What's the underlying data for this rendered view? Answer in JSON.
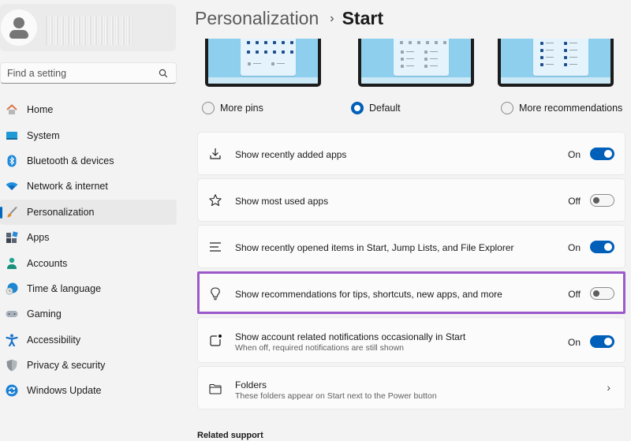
{
  "sidebar": {
    "search": {
      "placeholder": "Find a setting",
      "value": ""
    },
    "items": [
      {
        "label": "Home",
        "icon": "home-icon",
        "active": false
      },
      {
        "label": "System",
        "icon": "system-icon",
        "active": false
      },
      {
        "label": "Bluetooth & devices",
        "icon": "bluetooth-icon",
        "active": false
      },
      {
        "label": "Network & internet",
        "icon": "wifi-icon",
        "active": false
      },
      {
        "label": "Personalization",
        "icon": "brush-icon",
        "active": true
      },
      {
        "label": "Apps",
        "icon": "apps-icon",
        "active": false
      },
      {
        "label": "Accounts",
        "icon": "accounts-icon",
        "active": false
      },
      {
        "label": "Time & language",
        "icon": "globe-clock-icon",
        "active": false
      },
      {
        "label": "Gaming",
        "icon": "gamepad-icon",
        "active": false
      },
      {
        "label": "Accessibility",
        "icon": "accessibility-icon",
        "active": false
      },
      {
        "label": "Privacy & security",
        "icon": "shield-icon",
        "active": false
      },
      {
        "label": "Windows Update",
        "icon": "update-icon",
        "active": false
      }
    ]
  },
  "header": {
    "breadcrumb_parent": "Personalization",
    "separator": "›",
    "current": "Start"
  },
  "layouts": {
    "options": [
      {
        "label": "More pins",
        "selected": false
      },
      {
        "label": "Default",
        "selected": true
      },
      {
        "label": "More recommendations",
        "selected": false
      }
    ]
  },
  "settings": [
    {
      "label": "Show recently added apps",
      "icon": "download-icon",
      "state": "On",
      "on": true
    },
    {
      "label": "Show most used apps",
      "icon": "star-icon",
      "state": "Off",
      "on": false
    },
    {
      "label": "Show recently opened items in Start, Jump Lists, and File Explorer",
      "icon": "list-icon",
      "state": "On",
      "on": true
    },
    {
      "label": "Show recommendations for tips, shortcuts, new apps, and more",
      "icon": "lightbulb-icon",
      "state": "Off",
      "on": false,
      "highlighted": true
    },
    {
      "label": "Show account related notifications occasionally in Start",
      "sublabel": "When off, required notifications are still shown",
      "icon": "notification-icon",
      "state": "On",
      "on": true
    },
    {
      "label": "Folders",
      "sublabel": "These folders appear on Start next to the Power button",
      "icon": "folder-icon"
    }
  ],
  "related_support": {
    "heading": "Related support"
  },
  "colors": {
    "accent": "#005fb8",
    "highlight": "#9b59c9"
  }
}
